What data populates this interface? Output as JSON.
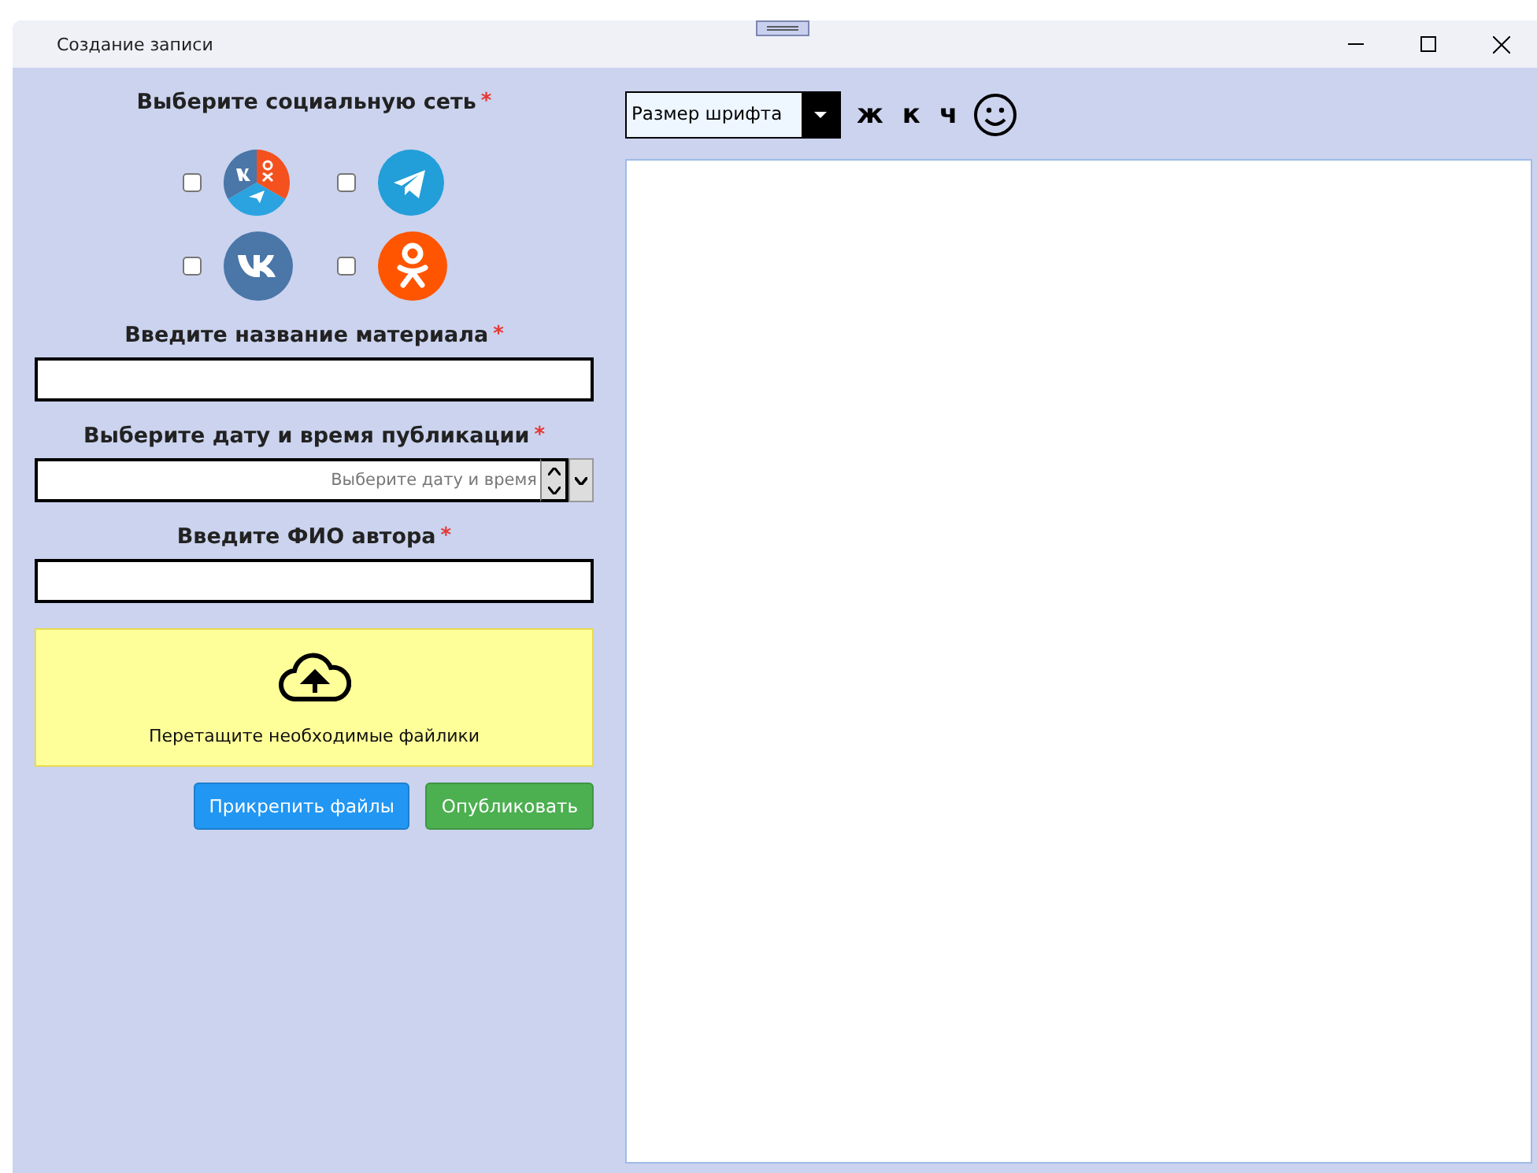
{
  "window": {
    "title": "Создание записи"
  },
  "social": {
    "label": "Выберите социальную сеть",
    "required": "*",
    "items": [
      {
        "kind": "all",
        "checked": false
      },
      {
        "kind": "telegram",
        "checked": false
      },
      {
        "kind": "vk",
        "checked": false
      },
      {
        "kind": "ok",
        "checked": false
      }
    ]
  },
  "fields": [
    {
      "kind": "text",
      "label": "Введите название материала",
      "required": "*"
    },
    {
      "kind": "datetime",
      "label": "Выберите дату и время публикации",
      "required": "*",
      "placeholder": "Выберите дату и время"
    },
    {
      "kind": "text",
      "label": "Введите ФИО автора",
      "required": "*"
    }
  ],
  "dropzone": {
    "text": "Перетащите необходимые файлики"
  },
  "buttons": [
    {
      "label": "Прикрепить файлы",
      "color": "#2196f3"
    },
    {
      "label": "Опубликовать",
      "color": "#4caf50"
    }
  ],
  "toolbar": {
    "font_size": {
      "placeholder": "Размер шрифта"
    },
    "format_buttons": [
      "ж",
      "к",
      "ч"
    ]
  }
}
